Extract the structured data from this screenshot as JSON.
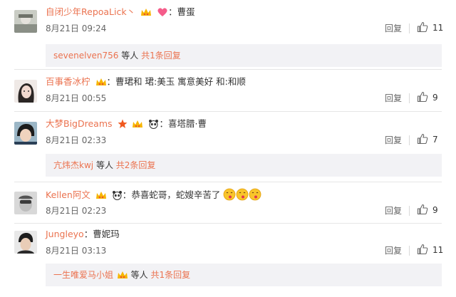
{
  "reply_label": "回复",
  "deng_ren": "等人",
  "colon": "：",
  "comments": [
    {
      "username": "自闭少年RepoaLick丶",
      "text": "曹蛋",
      "time": "8月21日 09:24",
      "likes": "11",
      "sub": {
        "name": "sevenelven756",
        "count": "共1条回复"
      }
    },
    {
      "username": "百事香冰柠",
      "text": "曹珺和 珺:美玉 寓意美好 和:和顺",
      "time": "8月21日 00:55",
      "likes": "9"
    },
    {
      "username": "大梦BigDreams",
      "text": "喜塔腊·曹",
      "time": "8月21日 02:33",
      "likes": "7",
      "sub": {
        "name": "亢炜杰kwj",
        "count": "共2条回复"
      }
    },
    {
      "username": "Kellen阿文",
      "text": "恭喜蛇哥，蛇嫂辛苦了",
      "time": "8月21日 02:23",
      "likes": "9"
    },
    {
      "username": "Jungleyo",
      "text": "曹妮玛",
      "time": "8月21日 03:13",
      "likes": "11",
      "sub": {
        "name": "一生唯爱马小姐",
        "count": "共1条回复"
      }
    }
  ],
  "colors": {
    "accent": "#eb7350",
    "subbox_bg": "#f2f2f5"
  }
}
